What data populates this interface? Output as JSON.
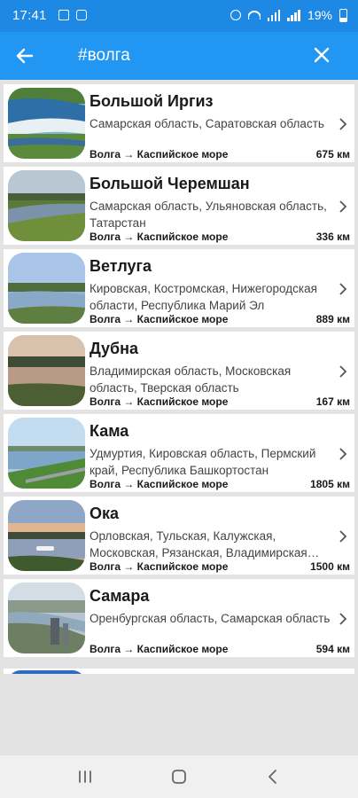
{
  "status_bar": {
    "time": "17:41",
    "battery": "19%"
  },
  "app_bar": {
    "title": "#волга"
  },
  "rivers": [
    {
      "name": "Большой Иргиз",
      "regions": "Самарская область, Саратовская область",
      "route": "Волга → Каспийское море",
      "length": "675 км"
    },
    {
      "name": "Большой Черемшан",
      "regions": "Самарская область, Ульяновская область, Татарстан",
      "route": "Волга → Каспийское море",
      "length": "336 км"
    },
    {
      "name": "Ветлуга",
      "regions": "Кировская, Костромская, Нижегородская области, Республика Марий Эл",
      "route": "Волга → Каспийское море",
      "length": "889 км"
    },
    {
      "name": "Дубна",
      "regions": "Владимирская область, Московская область, Тверская область",
      "route": "Волга → Каспийское море",
      "length": "167 км"
    },
    {
      "name": "Кама",
      "regions": "Удмуртия, Кировская область, Пермский край, Республика Башкортостан",
      "route": "Волга → Каспийское море",
      "length": "1805 км"
    },
    {
      "name": "Ока",
      "regions": "Орловская, Тульская, Калужская, Московская, Рязанская, Владимирская области",
      "route": "Волга → Каспийское море",
      "length": "1500 км"
    },
    {
      "name": "Самара",
      "regions": "Оренбургская область, Самарская область",
      "route": "Волга → Каспийское море",
      "length": "594 км"
    }
  ],
  "colors": {
    "status_bar": "#1e88e5",
    "app_bar": "#2196f3",
    "background": "#e3e3e3",
    "card": "#ffffff",
    "nav_bar": "#f0f0f0"
  },
  "icons": {
    "back": "arrow-left-icon",
    "close": "close-icon",
    "chevron": "chevron-right-icon",
    "nav_recent": "recent-apps-icon",
    "nav_home": "home-icon",
    "nav_back": "nav-back-icon"
  }
}
